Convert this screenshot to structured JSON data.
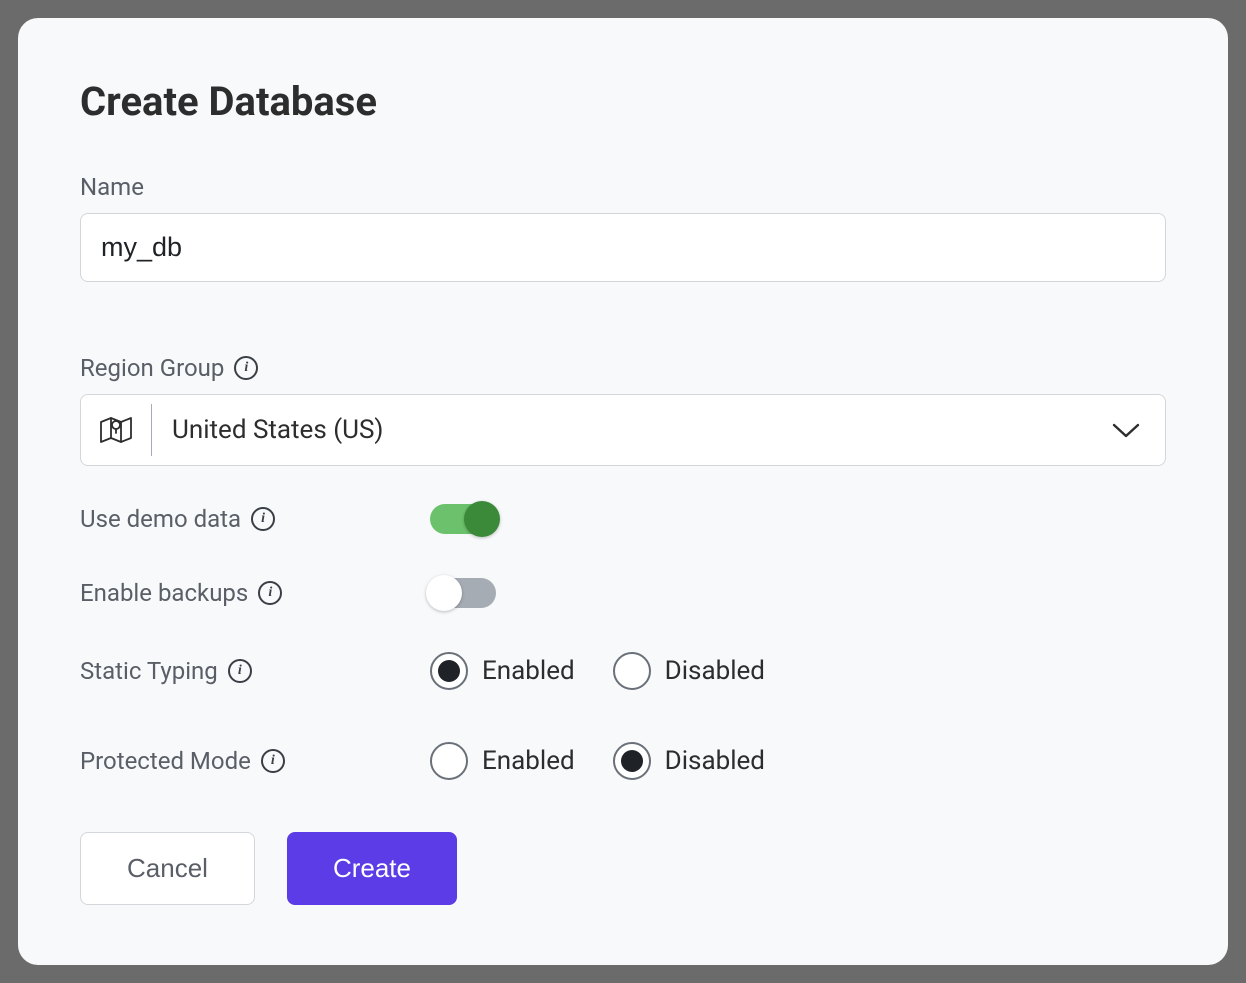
{
  "dialog": {
    "title": "Create Database",
    "name": {
      "label": "Name",
      "value": "my_db"
    },
    "region": {
      "label": "Region Group",
      "selected": "United States (US)"
    },
    "demo_data": {
      "label": "Use demo data",
      "enabled": true
    },
    "backups": {
      "label": "Enable backups",
      "enabled": false
    },
    "static_typing": {
      "label": "Static Typing",
      "option_enabled": "Enabled",
      "option_disabled": "Disabled",
      "value": "enabled"
    },
    "protected_mode": {
      "label": "Protected Mode",
      "option_enabled": "Enabled",
      "option_disabled": "Disabled",
      "value": "disabled"
    },
    "buttons": {
      "cancel": "Cancel",
      "create": "Create"
    }
  }
}
